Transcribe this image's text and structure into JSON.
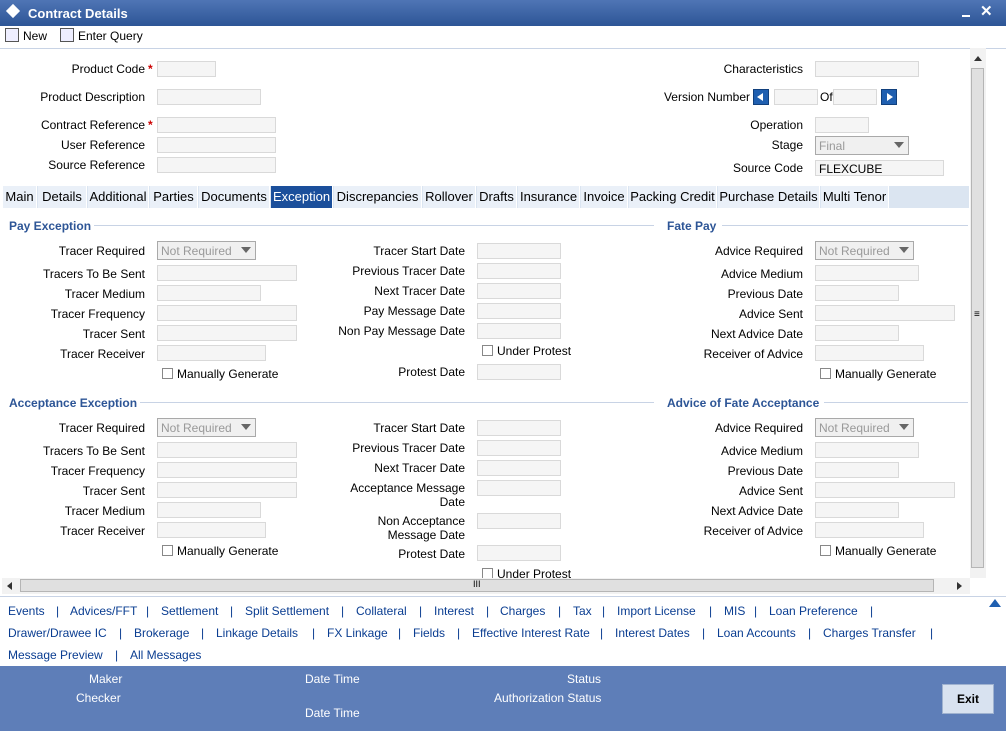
{
  "window": {
    "title": "Contract Details"
  },
  "toolbar": {
    "new_label": "New",
    "enter_query_label": "Enter Query"
  },
  "header": {
    "product_code": "Product Code",
    "product_description": "Product Description",
    "contract_reference": "Contract Reference",
    "user_reference": "User Reference",
    "source_reference": "Source Reference",
    "characteristics": "Characteristics",
    "version_number": "Version Number",
    "of": "Of",
    "operation": "Operation",
    "stage": "Stage",
    "stage_value": "Final",
    "source_code": "Source Code",
    "source_code_value": "FLEXCUBE",
    "required_mark": "*"
  },
  "tabs": [
    "Main",
    "Details",
    "Additional",
    "Parties",
    "Documents",
    "Exception",
    "Discrepancies",
    "Rollover",
    "Drafts",
    "Insurance",
    "Invoice",
    "Packing Credit",
    "Purchase Details",
    "Multi Tenor"
  ],
  "pay_exception": {
    "title": "Pay Exception",
    "tracer_required": "Tracer Required",
    "tracer_required_value": "Not Required",
    "tracers_to_be_sent": "Tracers To Be Sent",
    "tracer_medium": "Tracer Medium",
    "tracer_frequency": "Tracer Frequency",
    "tracer_sent": "Tracer Sent",
    "tracer_receiver": "Tracer Receiver",
    "manually_generate": "Manually Generate",
    "tracer_start_date": "Tracer Start Date",
    "previous_tracer_date": "Previous Tracer Date",
    "next_tracer_date": "Next Tracer Date",
    "pay_message_date": "Pay Message Date",
    "non_pay_message_date": "Non Pay Message Date",
    "under_protest": "Under Protest",
    "protest_date": "Protest Date"
  },
  "fate_pay": {
    "title": "Fate Pay",
    "advice_required": "Advice Required",
    "advice_required_value": "Not Required",
    "advice_medium": "Advice Medium",
    "previous_date": "Previous Date",
    "advice_sent": "Advice Sent",
    "next_advice_date": "Next Advice Date",
    "receiver_of_advice": "Receiver of Advice",
    "manually_generate": "Manually Generate"
  },
  "acceptance_exception": {
    "title": "Acceptance Exception",
    "tracer_required": "Tracer Required",
    "tracer_required_value": "Not Required",
    "tracers_to_be_sent": "Tracers To Be Sent",
    "tracer_frequency": "Tracer Frequency",
    "tracer_sent": "Tracer Sent",
    "tracer_medium": "Tracer Medium",
    "tracer_receiver": "Tracer Receiver",
    "manually_generate": "Manually Generate",
    "tracer_start_date": "Tracer Start Date",
    "previous_tracer_date": "Previous Tracer Date",
    "next_tracer_date": "Next Tracer Date",
    "acceptance_message": "Acceptance Message",
    "date": "Date",
    "non_acceptance": "Non Acceptance",
    "message_date": "Message Date",
    "protest_date": "Protest Date",
    "under_protest": "Under Protest"
  },
  "advice_fate_acceptance": {
    "title": "Advice of Fate Acceptance",
    "advice_required": "Advice Required",
    "advice_required_value": "Not Required",
    "advice_medium": "Advice Medium",
    "previous_date": "Previous Date",
    "advice_sent": "Advice Sent",
    "next_advice_date": "Next Advice Date",
    "receiver_of_advice": "Receiver of Advice",
    "manually_generate": "Manually Generate"
  },
  "links": {
    "row1": [
      "Events",
      "Advices/FFT",
      "Settlement",
      "Split Settlement",
      "Collateral",
      "Interest",
      "Charges",
      "Tax",
      "Import License",
      "MIS",
      "Loan Preference"
    ],
    "row2": [
      "Drawer/Drawee IC",
      "Brokerage",
      "Linkage Details",
      "FX Linkage",
      "Fields",
      "Effective Interest Rate",
      "Interest Dates",
      "Loan Accounts",
      "Charges Transfer"
    ],
    "row3": [
      "Message Preview",
      "All Messages"
    ],
    "separator": "|"
  },
  "footer": {
    "maker": "Maker",
    "checker": "Checker",
    "date_time": "Date Time",
    "status": "Status",
    "authorization_status": "Authorization Status",
    "exit": "Exit"
  },
  "scroll": {
    "grip": "III",
    "grip_v": "≡"
  }
}
